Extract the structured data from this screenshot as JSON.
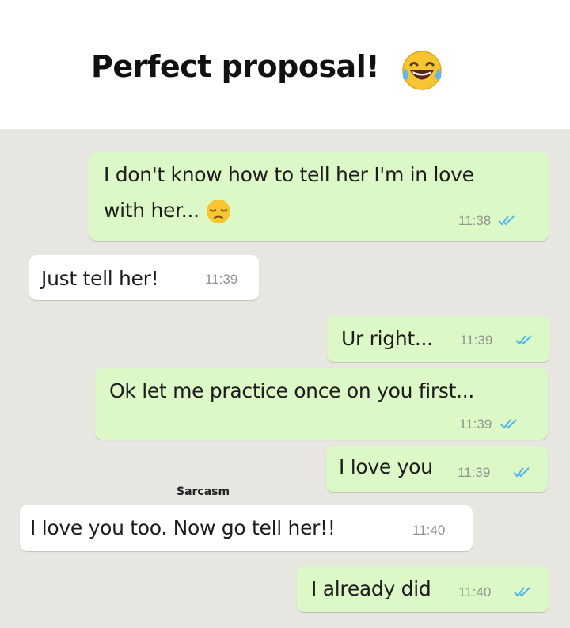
{
  "header": {
    "title": "Perfect proposal!",
    "emoji": "face-with-tears-of-joy-icon"
  },
  "watermark": "Sarcasm",
  "colors": {
    "outgoing": "#dcf8c6",
    "incoming": "#ffffff",
    "background": "#e8e6e1",
    "read_ticks": "#4fb6ec"
  },
  "messages": [
    {
      "direction": "outgoing",
      "line1": "I don't know how to tell her I'm in love",
      "line2": "with her...",
      "emoji": "pensive-face-icon",
      "time": "11:38",
      "status": "read"
    },
    {
      "direction": "incoming",
      "text": "Just tell her!",
      "time": "11:39"
    },
    {
      "direction": "outgoing",
      "text": "Ur right...",
      "time": "11:39",
      "status": "read"
    },
    {
      "direction": "outgoing",
      "text": "Ok let me practice once on you first...",
      "time": "11:39",
      "status": "read"
    },
    {
      "direction": "outgoing",
      "text": "I love you",
      "time": "11:39",
      "status": "read"
    },
    {
      "direction": "incoming",
      "text": "I love you too. Now go tell her!!",
      "time": "11:40"
    },
    {
      "direction": "outgoing",
      "text": "I already did",
      "time": "11:40",
      "status": "read"
    }
  ]
}
